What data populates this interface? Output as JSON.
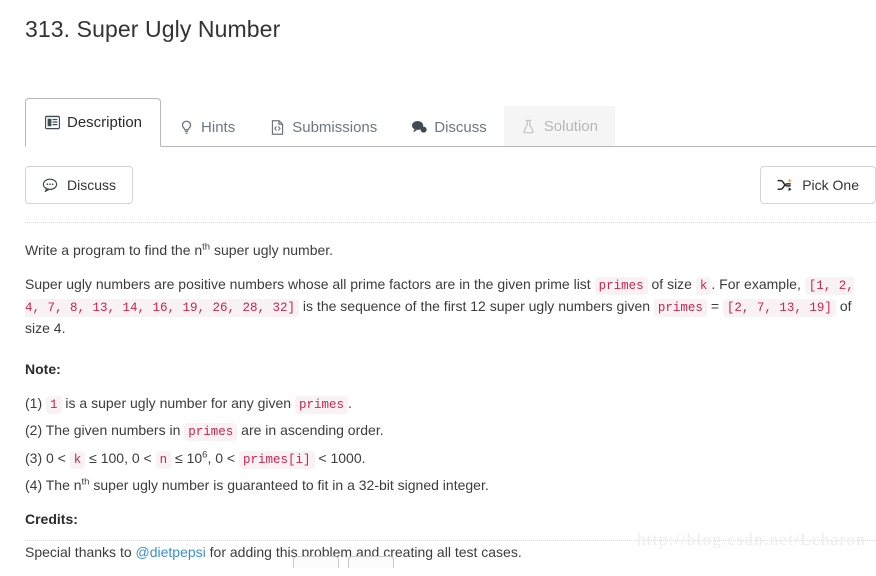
{
  "page": {
    "title": "313. Super Ugly Number",
    "watermark": "http://blog.csdn.net/Lcharon"
  },
  "tabs": [
    {
      "label": "Description",
      "icon": "description-icon",
      "state": "active"
    },
    {
      "label": "Hints",
      "icon": "lightbulb-icon",
      "state": "normal"
    },
    {
      "label": "Submissions",
      "icon": "file-code-icon",
      "state": "normal"
    },
    {
      "label": "Discuss",
      "icon": "comment-filled-icon",
      "state": "normal"
    },
    {
      "label": "Solution",
      "icon": "flask-icon",
      "state": "disabled"
    }
  ],
  "toolbar": {
    "discuss_label": "Discuss",
    "discuss_icon": "comment-outline-icon",
    "pick_one_label": "Pick One",
    "pick_one_icon": "shuffle-icon"
  },
  "description": {
    "intro_before": "Write a program to find the n",
    "intro_sup": "th",
    "intro_after": " super ugly number.",
    "para2_a": "Super ugly numbers are positive numbers whose all prime factors are in the given prime list ",
    "para2_code1": "primes",
    "para2_b": " of size ",
    "para2_code2": "k",
    "para2_c": ". For example, ",
    "para2_code3": "[1, 2, 4, 7, 8, 13, 14, 16, 19, 26, 28, 32]",
    "para2_d": " is the sequence of the first 12 super ugly numbers given ",
    "para2_code4": "primes",
    "para2_e": " = ",
    "para2_code5": "[2, 7, 13, 19]",
    "para2_f": " of size 4."
  },
  "note": {
    "heading": "Note:",
    "item1_a": "(1) ",
    "item1_code": "1",
    "item1_b": " is a super ugly number for any given ",
    "item1_code2": "primes",
    "item1_c": ".",
    "item2_a": "(2) The given numbers in ",
    "item2_code": "primes",
    "item2_b": " are in ascending order.",
    "item3_a": "(3) 0 < ",
    "item3_code1": "k",
    "item3_b": " ≤ 100, 0 < ",
    "item3_code2": "n",
    "item3_c": " ≤ 10",
    "item3_sup": "6",
    "item3_d": ", 0 < ",
    "item3_code3": "primes[i]",
    "item3_e": " < 1000.",
    "item4_a": "(4) The n",
    "item4_sup": "th",
    "item4_b": " super ugly number is guaranteed to fit in a 32-bit signed integer."
  },
  "credits": {
    "heading": "Credits:",
    "text_before": "Special thanks to ",
    "link": "@dietpepsi",
    "text_after": " for adding this problem and creating all test cases."
  },
  "colors": {
    "code_text": "#c7254e",
    "code_bg": "#f9f2f4",
    "link": "#3a8fd4",
    "border": "#b6b6b6",
    "watermark": "#ececec"
  }
}
